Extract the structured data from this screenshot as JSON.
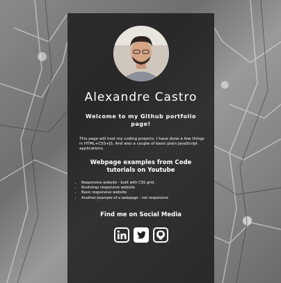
{
  "profile": {
    "name": "Alexandre Castro",
    "welcome": "Welcome to my Github portfolio page!",
    "intro": "This page will host my coding projects. I have done a few things in HTML+CSS+JS. And also a couple of basic plain JavaScript applications."
  },
  "examples": {
    "title": "Webpage examples from Code tutorials on Youtube",
    "items": [
      "Responsive website - built with CSS grid.",
      "Bootstrap responsive website",
      "Basic responsive website",
      "Another example of a webpage - not responsive"
    ]
  },
  "social": {
    "title": "Find me on Social Media",
    "icons": [
      "linkedin-icon",
      "twitter-icon",
      "github-icon"
    ]
  },
  "colors": {
    "card_background": "#141414",
    "text": "#ffffff"
  }
}
